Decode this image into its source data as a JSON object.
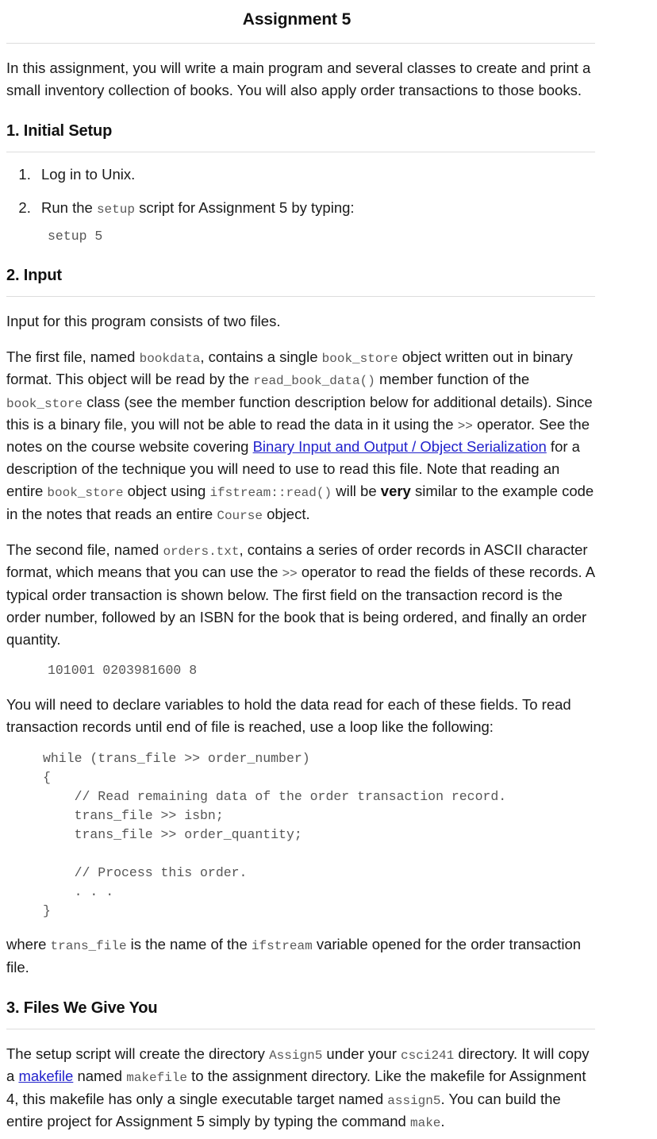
{
  "document": {
    "title": "Assignment 5",
    "intro": {
      "before": "In this assignment, you will write a main program and several classes to create and print a small inventory collection of books. You will also apply order transactions to those books."
    },
    "sections": [
      {
        "heading": "1. Initial Setup",
        "steps": [
          {
            "text_before": "Log in to Unix.",
            "code": "",
            "text_after": ""
          },
          {
            "text_before": "Run the ",
            "code": "setup",
            "text_after": " script for Assignment 5 by typing:"
          }
        ],
        "code_block": "setup 5"
      },
      {
        "heading": "2. Input",
        "p1": "Input for this program consists of two files.",
        "p2": {
          "s1": "The first file, named ",
          "c1": "bookdata",
          "s2": ", contains a single ",
          "c2": "book_store",
          "s3": " object written out in binary format. This object will be read by the ",
          "c3": "read_book_data()",
          "s4": " member function of the ",
          "c4": "book_store",
          "s5": " class (see the member function description below for additional details). Since this is a binary file, you will not be able to read the data in it using the ",
          "c5": ">>",
          "s6": " operator. See the notes on the course website covering ",
          "link": "Binary Input and Output / Object Serialization",
          "s7": " for a description of the technique you will need to use to read this file. Note that reading an entire ",
          "c6": "book_store",
          "s8": " object using ",
          "c7": "ifstream::read()",
          "s9": " will be ",
          "bold": "very",
          "s10": " similar to the example code in the notes that reads an entire ",
          "c8": "Course",
          "s11": " object."
        },
        "p3": {
          "s1": "The second file, named ",
          "c1": "orders.txt",
          "s2": ", contains a series of order records in ASCII character format, which means that you can use the ",
          "c2": ">>",
          "s3": " operator to read the fields of these records. A typical order transaction is shown below. The first field on the transaction record is the order number, followed by an ISBN for the book that is being ordered, and finally an order quantity."
        },
        "sample_record": "101001 0203981600 8",
        "p4": "You will need to declare variables to hold the data read for each of these fields. To read transaction records until end of file is reached, use a loop like the following:",
        "loop_code": "while (trans_file >> order_number)\n{\n    // Read remaining data of the order transaction record.\n    trans_file >> isbn;\n    trans_file >> order_quantity;\n\n    // Process this order.\n    . . .\n}",
        "p5": {
          "s1": "where ",
          "c1": "trans_file",
          "s2": " is the name of the ",
          "c2": "ifstream",
          "s3": " variable opened for the order transaction file."
        }
      },
      {
        "heading": "3. Files We Give You",
        "p1": {
          "s1": "The setup script will create the directory ",
          "c1": "Assign5",
          "s2": " under your ",
          "c2": "csci241",
          "s3": " directory. It will copy a ",
          "link": "makefile",
          "s4": " named ",
          "c3": "makefile",
          "s5": " to the assignment directory. Like the makefile for Assignment 4, this makefile has only a single executable target named ",
          "c4": "assign5",
          "s6": ". You can build the entire project for Assignment 5 simply by typing the command ",
          "c5": "make",
          "s7": "."
        }
      }
    ],
    "colors": {
      "link": "#2222cc",
      "code_text": "#585858",
      "rule": "#dddddd",
      "body_text": "#1a1a1a"
    }
  }
}
